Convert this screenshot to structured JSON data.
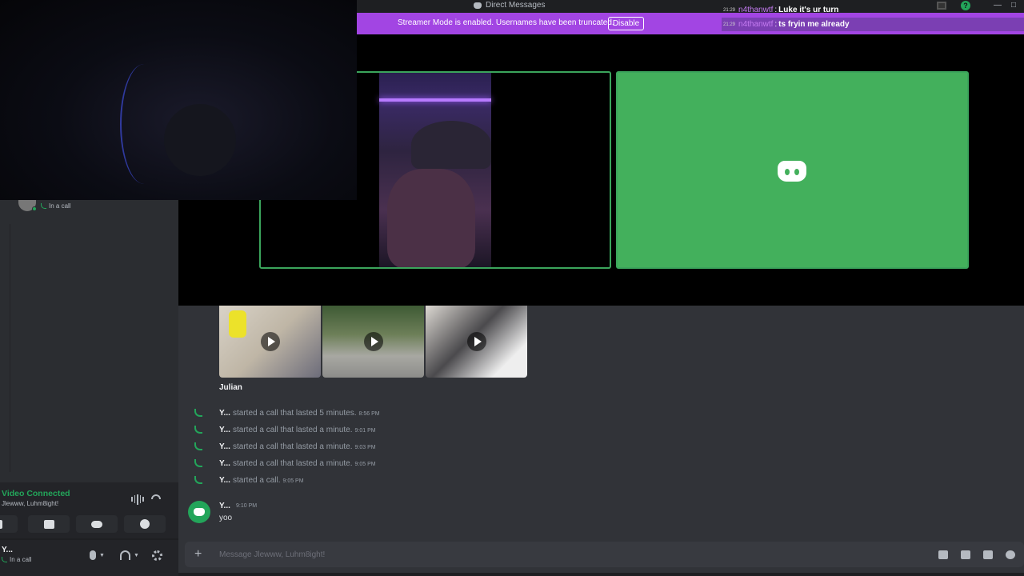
{
  "window": {
    "title": "Direct Messages"
  },
  "banner": {
    "message": "Streamer Mode is enabled. Usernames have been truncated.",
    "disable_label": "Disable"
  },
  "chat_overlay": [
    {
      "time": "21:29",
      "user": "n4thanwtf",
      "text": "Luke it's ur turn"
    },
    {
      "time": "21:29",
      "user": "n4thanwtf",
      "text": "ts fryin me already"
    }
  ],
  "sidebar": {
    "dm_status": "In a call"
  },
  "voice_panel": {
    "status": "Video Connected",
    "names": "Jlewww, Luhm8ight!"
  },
  "user_panel": {
    "name": "Y...",
    "status": "In a call"
  },
  "messages": {
    "attachment_sender": "Julian",
    "calls": [
      {
        "user": "Y...",
        "text": "started a call that lasted 5 minutes.",
        "time": "8:56 PM"
      },
      {
        "user": "Y...",
        "text": "started a call that lasted a minute.",
        "time": "9:01 PM"
      },
      {
        "user": "Y...",
        "text": "started a call that lasted a minute.",
        "time": "9:03 PM"
      },
      {
        "user": "Y...",
        "text": "started a call that lasted a minute.",
        "time": "9:05 PM"
      },
      {
        "user": "Y...",
        "text": "started a call.",
        "time": "9:05 PM"
      }
    ],
    "last": {
      "author": "Y...",
      "time": "9:10 PM",
      "text": "yoo"
    }
  },
  "composer": {
    "placeholder": "Message Jlewww, Luhm8ight!"
  },
  "colors": {
    "streamer_banner": "#a245e3",
    "speaking_border": "#3ba55c",
    "video_tile": "#43b05c",
    "call_icon": "#23a55a"
  }
}
